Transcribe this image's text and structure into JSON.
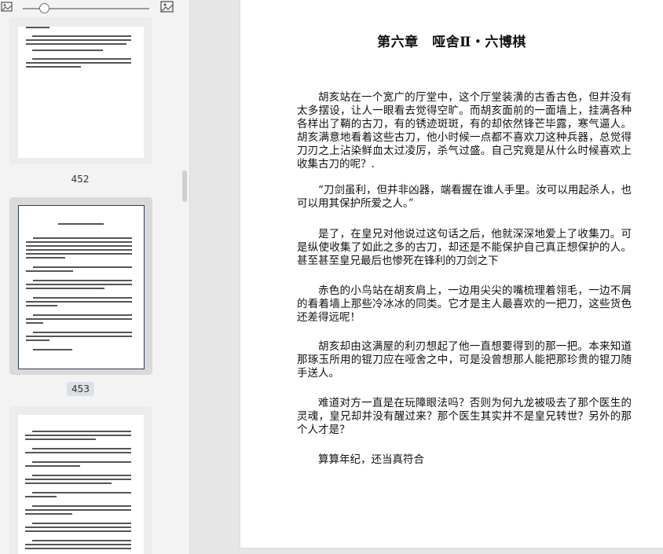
{
  "sidebar": {
    "thumbnails": [
      {
        "page": "452"
      },
      {
        "page": "453"
      },
      {
        "page": ""
      }
    ]
  },
  "document": {
    "chapter_title": "第六章　哑舍Ⅱ・六博棋",
    "paragraphs": [
      "胡亥站在一个宽广的厅堂中，这个厅堂装潢的古香古色，但并没有太多摆设，让人一眼看去觉得空旷。而胡亥面前的一面墙上，挂满各种各样出了鞘的古刀，有的锈迹斑斑，有的却依然锋芒毕露，寒气逼人。胡亥满意地看着这些古刀，他小时候一点都不喜欢刀这种兵器，总觉得刀刃之上沾染鲜血太过凌厉，杀气过盛。自己究竟是从什么时候喜欢上收集古刀的呢？.",
      "“刀剑虽利，但并非凶器，端看握在谁人手里。汝可以用起杀人，也可以用其保护所爱之人。”",
      "是了，在皇兄对他说过这句话之后，他就深深地爱上了收集刀。可是纵使收集了如此之多的古刀，却还是不能保护自己真正想保护的人。甚至甚至皇兄最后也惨死在锋利的刀剑之下",
      "赤色的小鸟站在胡亥肩上，一边用尖尖的嘴梳理着翎毛，一边不屑的看着墙上那些冷冰冰的同类。它才是主人最喜欢的一把刀，这些货色还差得远呢！",
      "胡亥却由这满屋的利刃想起了他一直想要得到的那一把。本来知道那琢玉所用的锟刀应在哑舍之中，可是没曾想那人能把那珍贵的锟刀随手送人。",
      "难道对方一直是在玩障眼法吗？否则为何九龙被吸去了那个医生的灵魂，皇兄却并没有醒过来？那个医生其实并不是皇兄转世？另外的那个人才是？",
      "算算年纪，还当真符合"
    ]
  }
}
